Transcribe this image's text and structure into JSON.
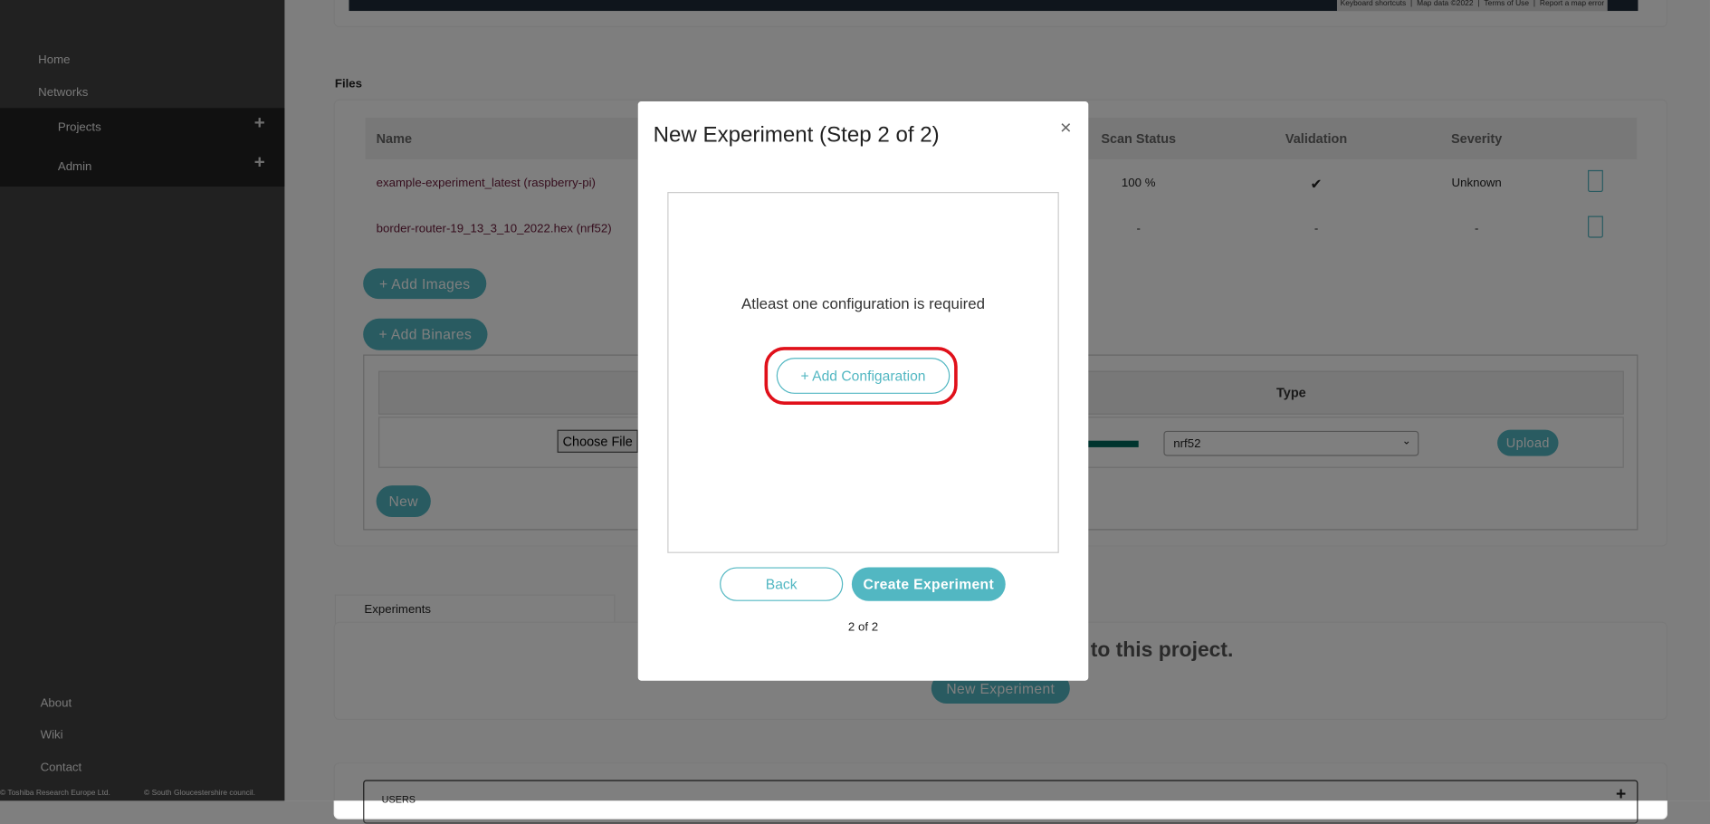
{
  "sidebar": {
    "items": [
      {
        "label": "Home"
      },
      {
        "label": "Networks"
      },
      {
        "label": "Projects"
      },
      {
        "label": "Admin"
      }
    ],
    "footer_links": [
      {
        "label": "About"
      },
      {
        "label": "Wiki"
      },
      {
        "label": "Contact"
      }
    ],
    "copyright": [
      "© Toshiba Research Europe Ltd.",
      "© South Gloucestershire council."
    ]
  },
  "map": {
    "attribution": [
      "Keyboard shortcuts",
      "Map data ©2022",
      "Terms of Use",
      "Report a map error"
    ]
  },
  "files": {
    "title": "Files",
    "columns": [
      "Name",
      "Scan Status",
      "Validation",
      "Severity"
    ],
    "rows": [
      {
        "name": "example-experiment_latest (raspberry-pi)",
        "scan": "100 %",
        "validation": "✔",
        "severity": "Unknown"
      },
      {
        "name": "border-router-19_13_3_10_2022.hex (nrf52)",
        "scan": "-",
        "validation": "-",
        "severity": "-"
      }
    ],
    "add_images": "+ Add Images",
    "add_binaries": "+ Add Binares",
    "upload_table": {
      "type_header": "Type",
      "choose_file": "Choose File",
      "type_value": "nrf52",
      "upload": "Upload",
      "progress": 1.0
    },
    "new_button": "New"
  },
  "experiments": {
    "tab": "Experiments",
    "empty_text": "to this project.",
    "new_button": "New Experiment"
  },
  "users": {
    "label": "USERS"
  },
  "modal": {
    "title": "New Experiment (Step 2 of 2)",
    "close": "×",
    "message": "Atleast one configuration is required",
    "add_config": "+ Add Configaration",
    "back": "Back",
    "create": "Create Experiment",
    "step": "2 of 2"
  }
}
